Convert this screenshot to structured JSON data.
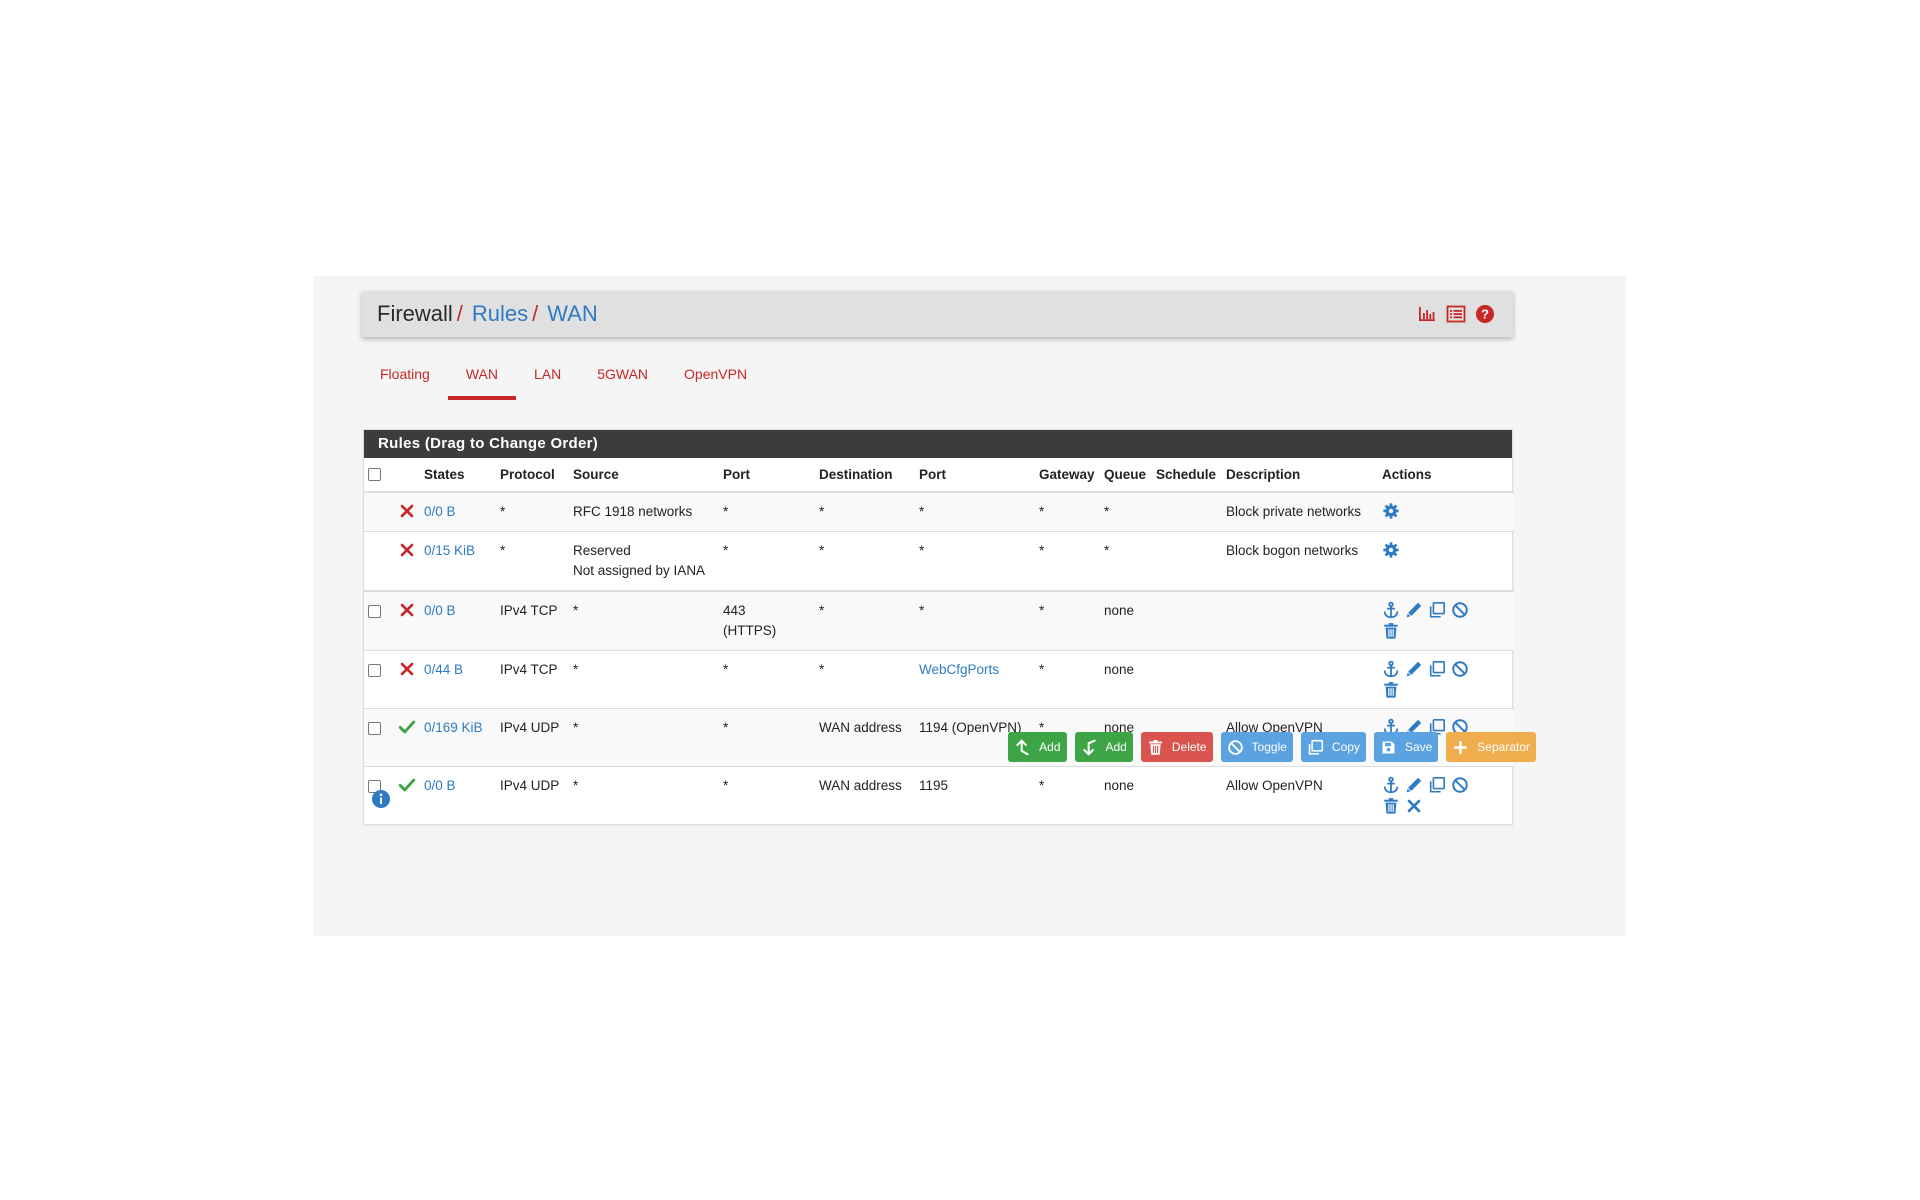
{
  "breadcrumb": {
    "root": "Firewall",
    "level1": "Rules",
    "level2": "WAN"
  },
  "header_icons": [
    "chart-icon",
    "list-icon",
    "help-icon"
  ],
  "tabs": [
    {
      "label": "Floating",
      "active": false
    },
    {
      "label": "WAN",
      "active": true
    },
    {
      "label": "LAN",
      "active": false
    },
    {
      "label": "5GWAN",
      "active": false
    },
    {
      "label": "OpenVPN",
      "active": false
    }
  ],
  "panel": {
    "title": "Rules (Drag to Change Order)"
  },
  "table": {
    "headers": [
      "States",
      "Protocol",
      "Source",
      "Port",
      "Destination",
      "Port",
      "Gateway",
      "Queue",
      "Schedule",
      "Description",
      "Actions"
    ],
    "rows": [
      {
        "states": "0/0 B",
        "protocol": "*",
        "source": "RFC 1918 networks",
        "source_port": "*",
        "destination": "*",
        "dest_port": "*",
        "gateway": "*",
        "queue": "*",
        "schedule": "",
        "description": "Block private networks",
        "status": "block",
        "checkbox": false,
        "actions": [
          "gear-icon"
        ]
      },
      {
        "states": "0/15 KiB",
        "protocol": "*",
        "source": "Reserved\nNot assigned by IANA",
        "source_port": "*",
        "destination": "*",
        "dest_port": "*",
        "gateway": "*",
        "queue": "*",
        "schedule": "",
        "description": "Block bogon networks",
        "status": "block",
        "checkbox": false,
        "actions": [
          "gear-icon"
        ]
      },
      {
        "states": "0/0 B",
        "protocol": "IPv4 TCP",
        "source": "*",
        "source_port": "443\n(HTTPS)",
        "destination": "*",
        "dest_port": "*",
        "gateway": "*",
        "queue": "none",
        "schedule": "",
        "description": "",
        "status": "block",
        "checkbox": true,
        "actions": [
          "anchor-icon",
          "pencil-icon",
          "copy-icon",
          "disable-icon",
          "trash-icon"
        ]
      },
      {
        "states": "0/44 B",
        "protocol": "IPv4 TCP",
        "source": "*",
        "source_port": "*",
        "destination": "*",
        "dest_port": "WebCfgPorts",
        "dest_port_link": true,
        "gateway": "*",
        "queue": "none",
        "schedule": "",
        "description": "",
        "status": "block",
        "checkbox": true,
        "actions": [
          "anchor-icon",
          "pencil-icon",
          "copy-icon",
          "disable-icon",
          "trash-icon"
        ]
      },
      {
        "states": "0/169 KiB",
        "protocol": "IPv4 UDP",
        "source": "*",
        "source_port": "*",
        "destination": "WAN address",
        "dest_port": "1194 (OpenVPN)",
        "gateway": "*",
        "queue": "none",
        "schedule": "",
        "description": "Allow OpenVPN",
        "status": "pass",
        "checkbox": true,
        "actions": [
          "anchor-icon",
          "pencil-icon",
          "copy-icon",
          "disable-icon",
          "trash-icon",
          "remove-icon"
        ]
      },
      {
        "states": "0/0 B",
        "protocol": "IPv4 UDP",
        "source": "*",
        "source_port": "*",
        "destination": "WAN address",
        "dest_port": "1195",
        "gateway": "*",
        "queue": "none",
        "schedule": "",
        "description": "Allow OpenVPN",
        "status": "pass",
        "checkbox": true,
        "actions": [
          "anchor-icon",
          "pencil-icon",
          "copy-icon",
          "disable-icon",
          "trash-icon",
          "remove-icon"
        ]
      }
    ]
  },
  "buttons": [
    {
      "label": "Add",
      "icon": "arrow-up-icon",
      "color": "#3ea546"
    },
    {
      "label": "Add",
      "icon": "arrow-down-icon",
      "color": "#3ea546"
    },
    {
      "label": "Delete",
      "icon": "trash-icon",
      "color": "#d9534f"
    },
    {
      "label": "Toggle",
      "icon": "disable-icon",
      "color": "#5aa2e0"
    },
    {
      "label": "Copy",
      "icon": "copy-icon",
      "color": "#5aa2e0"
    },
    {
      "label": "Save",
      "icon": "save-icon",
      "color": "#5aa2e0"
    },
    {
      "label": "Separator",
      "icon": "plus-icon",
      "color": "#f0ad4e"
    }
  ],
  "colors": {
    "accent_red": "#c62828",
    "link_blue": "#2e7bc4",
    "pass_green": "#3ea546",
    "block_red": "#c62828",
    "heading_dark": "#3c3c3c"
  }
}
